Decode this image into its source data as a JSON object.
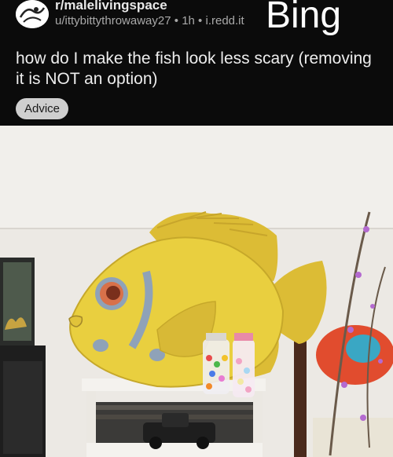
{
  "post": {
    "subreddit": "r/malelivingspace",
    "author": "u/ittybittythrowaway27",
    "age": "1h",
    "domain": "i.redd.it",
    "separator": "•",
    "title": "how do I make the fish look less scary (removing it is NOT an option)",
    "flair": "Advice"
  },
  "watermark": {
    "text": "Bing"
  },
  "image": {
    "subject": "wooden yellow fish wall decor",
    "colors": {
      "fish": "#e9cf3f",
      "fin": "#dcbc35",
      "eye": "#d8714a",
      "wall": "#ece9e4",
      "shelf": "#f4f2ee"
    }
  }
}
